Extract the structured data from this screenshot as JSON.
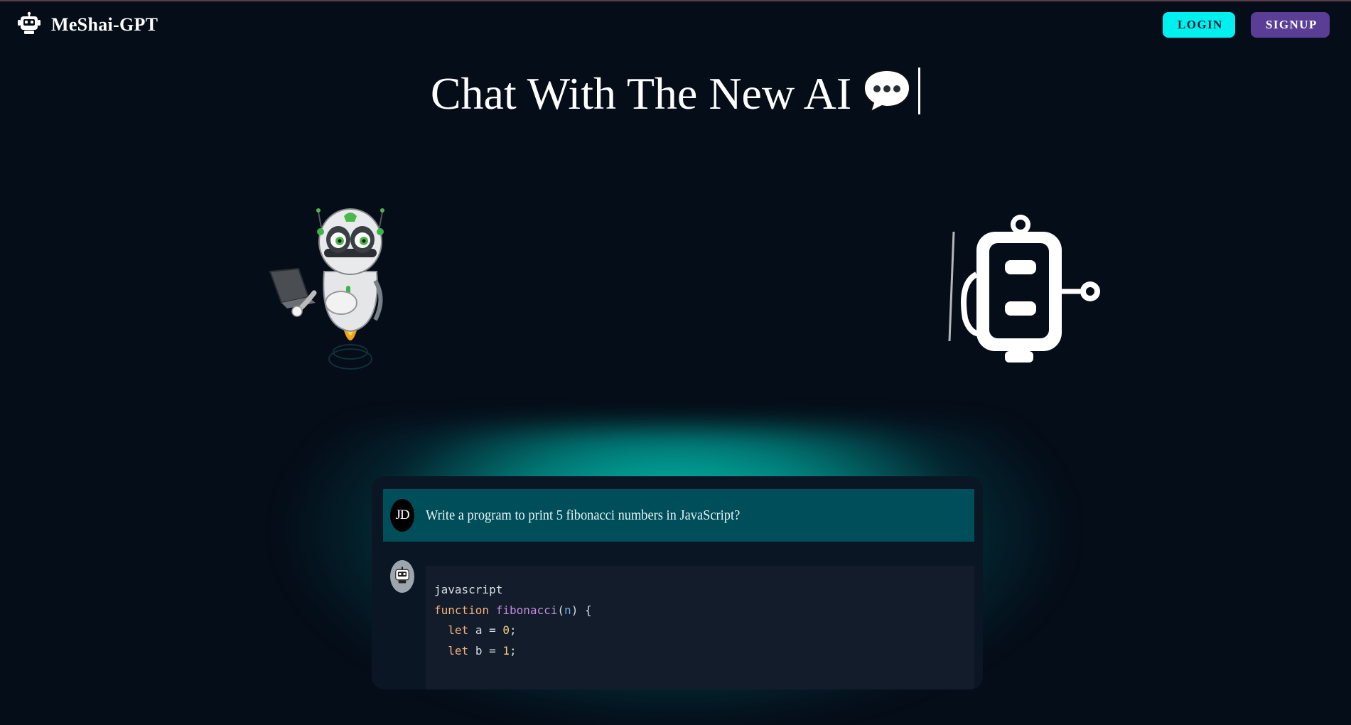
{
  "brand": {
    "name": "MeShai-GPT",
    "icon": "robot-icon"
  },
  "nav": {
    "login_label": "LOGIN",
    "signup_label": "SIGNUP"
  },
  "hero": {
    "title": "Chat With The New AI",
    "emoji": "speech-bubble-icon"
  },
  "chat": {
    "user": {
      "initials": "JD",
      "message": "Write a program to print 5 fibonacci numbers in JavaScript?"
    },
    "bot": {
      "avatar": "robot-icon",
      "code_language": "javascript",
      "code_lines": [
        {
          "kw": "function",
          "fn": "fibonacci",
          "open": "(",
          "param": "n",
          "close": ") {"
        },
        {
          "kw": "let",
          "rest": "a = ",
          "num": "0",
          "end": ";"
        },
        {
          "kw": "let",
          "rest": "b = ",
          "num": "1",
          "end": ";"
        }
      ]
    }
  },
  "colors": {
    "background": "#050d18",
    "login_button": "#00f0f0",
    "signup_button": "#5a3e95",
    "glow": "#00dcc8",
    "user_message_bg": "#004e5a",
    "code_bg": "#131c2a"
  },
  "illustrations": [
    "robot-with-laptop-illustration",
    "robot-outline-illustration"
  ]
}
